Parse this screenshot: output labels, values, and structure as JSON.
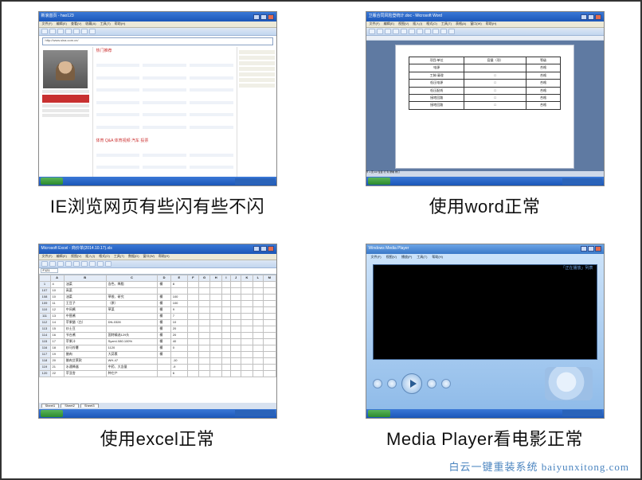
{
  "captions": {
    "ie": "IE浏览网页有些闪有些不闪",
    "word": "使用word正常",
    "excel": "使用excel正常",
    "wmp": "Media Player看电影正常"
  },
  "watermark": "白云一键重装系统 baiyunxitong.com",
  "ie": {
    "title": "新浪首页 - hao123",
    "menu": [
      "文件(F)",
      "编辑(E)",
      "查看(V)",
      "收藏(A)",
      "工具(T)",
      "帮助(H)"
    ],
    "url": "http://www.sina.com.cn/",
    "section": "热门推荐",
    "tabs": [
      "体育",
      "Q&A",
      "体育视频",
      "汽车",
      "投票"
    ]
  },
  "word": {
    "title": "卫版合同风险登统计.doc - Microsoft Word",
    "menu": [
      "文件(F)",
      "编辑(E)",
      "视图(V)",
      "插入(I)",
      "格式(O)",
      "工具(T)",
      "表格(A)",
      "窗口(W)",
      "帮助(H)"
    ],
    "table": {
      "headers": [
        "项目/单位",
        "容量（项）",
        "等级"
      ],
      "rows": [
        [
          "电源",
          "",
          "合格"
        ],
        [
          "工装/清理",
          "□",
          "合格"
        ],
        [
          "低压电源",
          "□",
          "合格"
        ],
        [
          "低压配线",
          "□",
          "合格"
        ],
        [
          "接地回路",
          "□",
          "合格"
        ],
        [
          "接地回路",
          "□",
          "合格"
        ]
      ]
    },
    "status": "节 1  页 1/2  位置  行  列  录制  修订"
  },
  "excel": {
    "title": "Microsoft Excel - 商价单(2014.10.17).xls",
    "menu": [
      "文件(F)",
      "编辑(E)",
      "视图(V)",
      "插入(I)",
      "格式(O)",
      "工具(T)",
      "数据(D)",
      "窗口(W)",
      "帮助(H)"
    ],
    "namebox": "F121",
    "columns": [
      "A",
      "B",
      "C",
      "D",
      "E",
      "F",
      "G",
      "H",
      "I",
      "J",
      "K",
      "L",
      "M"
    ],
    "rows": [
      {
        "n": 1,
        "c": [
          "4",
          "油菜",
          "含色、降脂",
          "桶",
          "8",
          "",
          "",
          "",
          "",
          "",
          "",
          "",
          ""
        ]
      },
      {
        "n": 107,
        "c": [
          "10",
          "高菜",
          "",
          "",
          "",
          "",
          "",
          "",
          "",
          "",
          "",
          "",
          ""
        ]
      },
      {
        "n": 108,
        "c": [
          "10",
          "油菜",
          "草根、研究",
          "桶",
          "100",
          "",
          "",
          "",
          "",
          "",
          "",
          "",
          ""
        ]
      },
      {
        "n": 109,
        "c": [
          "11",
          "王豆子",
          "（原）",
          "桶",
          "100",
          "",
          "",
          "",
          "",
          "",
          "",
          "",
          ""
        ]
      },
      {
        "n": 110,
        "c": [
          "12",
          "中间酱",
          "草菜",
          "桶",
          "9",
          "",
          "",
          "",
          "",
          "",
          "",
          "",
          ""
        ]
      },
      {
        "n": 111,
        "c": [
          "13",
          "中营酱",
          "",
          "桶",
          "7",
          "",
          "",
          "",
          "",
          "",
          "",
          "",
          ""
        ]
      },
      {
        "n": 112,
        "c": [
          "14",
          "苹果醋（白）",
          "DN-0328",
          "桶",
          "10",
          "",
          "",
          "",
          "",
          "",
          "",
          "",
          ""
        ]
      },
      {
        "n": 113,
        "c": [
          "15",
          "炒土豆",
          "",
          "桶",
          "20",
          "",
          "",
          "",
          "",
          "",
          "",
          "",
          ""
        ]
      },
      {
        "n": 114,
        "c": [
          "16",
          "节台酱",
          "国特精选129头",
          "桶",
          "20",
          "",
          "",
          "",
          "",
          "",
          "",
          "",
          ""
        ]
      },
      {
        "n": 115,
        "c": [
          "17",
          "苹果汁",
          "Syzml.X80.100%",
          "桶",
          "40",
          "",
          "",
          "",
          "",
          "",
          "",
          "",
          ""
        ]
      },
      {
        "n": 116,
        "c": [
          "18",
          "炒马铃薯",
          "1120",
          "桶",
          "0",
          "",
          "",
          "",
          "",
          "",
          "",
          "",
          ""
        ]
      },
      {
        "n": 117,
        "c": [
          "19",
          "腊肉",
          "大蒜素",
          "桶",
          "",
          "",
          "",
          "",
          "",
          "",
          "",
          "",
          ""
        ]
      },
      {
        "n": 118,
        "c": [
          "20",
          "腊肉艾莱款",
          "WH-47",
          "",
          "-10",
          "",
          "",
          "",
          "",
          "",
          "",
          "",
          ""
        ]
      },
      {
        "n": 119,
        "c": [
          "21",
          "水通降器",
          "中药、大含量",
          "",
          "-9",
          "",
          "",
          "",
          "",
          "",
          "",
          "",
          ""
        ]
      },
      {
        "n": 120,
        "c": [
          "22",
          "苹亚舍",
          "种它产",
          "",
          "6",
          "",
          "",
          "",
          "",
          "",
          "",
          "",
          ""
        ]
      }
    ],
    "sheets": [
      "Sheet1",
      "Sheet2",
      "Sheet3"
    ]
  },
  "wmp": {
    "title": "Windows Media Player",
    "menu": [
      "文件(F)",
      "视图(V)",
      "播放(P)",
      "工具(T)",
      "帮助(H)"
    ],
    "nowplaying_label": "「正在播放」列表"
  }
}
